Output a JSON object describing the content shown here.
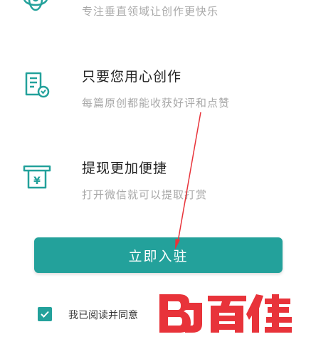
{
  "features": [
    {
      "icon": "brain-icon",
      "title": "",
      "desc": "专注垂直领域让创作更快乐"
    },
    {
      "icon": "document-check-icon",
      "title": "只要您用心创作",
      "desc": "每篇原创都能收获好评和点赞"
    },
    {
      "icon": "withdraw-yen-icon",
      "title": "提现更加便捷",
      "desc": "打开微信就可以提取打赏"
    }
  ],
  "join_button": {
    "label": "立即入驻"
  },
  "agreement": {
    "checked": true,
    "text": "我已阅读并同意"
  },
  "watermark": {
    "logo": "BJ",
    "text": "百佳"
  },
  "colors": {
    "accent": "#23a19b",
    "annotation_arrow": "#e8333a",
    "watermark": "#e8333a"
  }
}
